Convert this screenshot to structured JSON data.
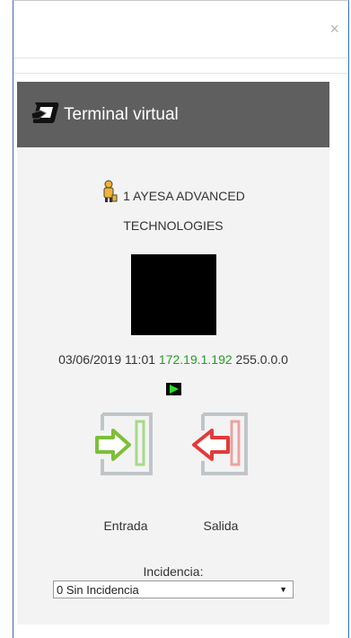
{
  "modal": {
    "close_symbol": "×"
  },
  "panel": {
    "title": "Terminal virtual"
  },
  "user": {
    "line1": "1 AYESA ADVANCED",
    "line2": "TECHNOLOGIES"
  },
  "network": {
    "datetime": "03/06/2019 11:01",
    "ip": "172.19.1.192",
    "mask": "255.0.0.0"
  },
  "actions": {
    "entrada_label": "Entrada",
    "salida_label": "Salida"
  },
  "incidencia": {
    "label": "Incidencia:",
    "selected": "0 Sin Incidencia"
  },
  "colors": {
    "header_bg": "#5f5f5f",
    "ip_green": "#2a9a2a",
    "entrada_green": "#7dbf3a",
    "salida_red": "#e23b3b"
  },
  "icons": [
    "close-icon",
    "terminal-hand-icon",
    "user-icon",
    "play-icon",
    "entrada-door-icon",
    "salida-door-icon",
    "chevron-down-icon"
  ]
}
